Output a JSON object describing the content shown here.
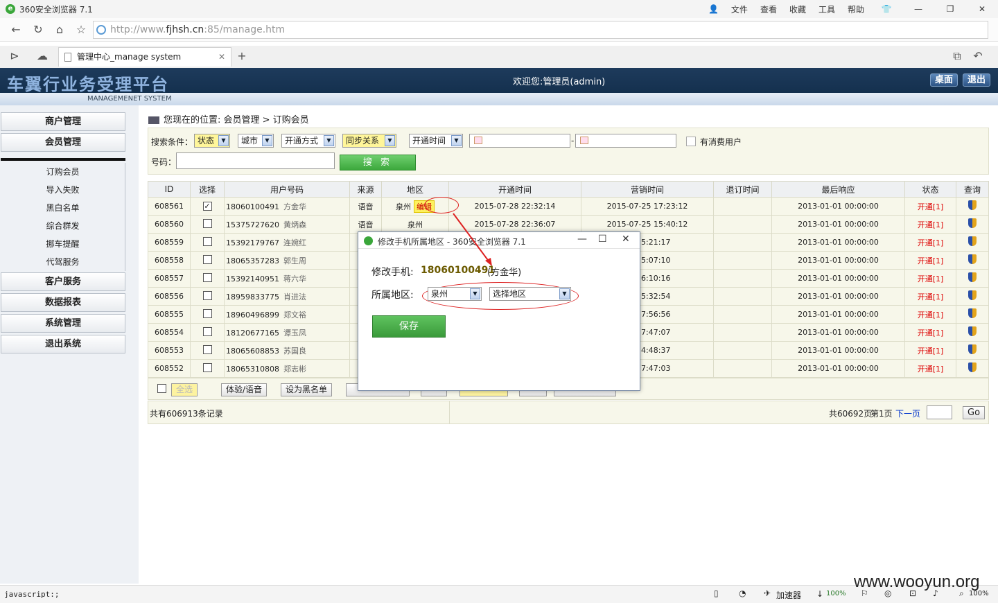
{
  "browser": {
    "title": "360安全浏览器 7.1",
    "menu": [
      "文件",
      "查看",
      "收藏",
      "工具",
      "帮助"
    ],
    "url_prefix": "http://www.",
    "url_host": "fjhsh.cn",
    "url_rest": ":85/manage.htm",
    "tab_title": "管理中心_manage system",
    "status_text": "javascript:;",
    "accelerator": "加速器",
    "zoom1": "100%",
    "zoom2": "100%"
  },
  "header": {
    "brand": "车翼行业务受理平台",
    "subtitle": "MANAGEMENET SYSTEM",
    "welcome": "欢迎您:管理员(admin)",
    "desktop_btn": "桌面",
    "logout_btn": "退出"
  },
  "sidebar": {
    "top": [
      "商户管理",
      "会员管理"
    ],
    "subs": [
      "订购会员",
      "导入失败",
      "黑白名单",
      "综合群发",
      "挪车提醒",
      "代驾服务"
    ],
    "bottom": [
      "客户服务",
      "数据报表",
      "系统管理",
      "退出系统"
    ]
  },
  "crumb": "您现在的位置: 会员管理 > 订购会员",
  "search": {
    "label": "搜索条件：",
    "status": "状态",
    "city": "城市",
    "open_mode": "开通方式",
    "sync": "同步关系",
    "open_time": "开通时间",
    "consume": "有消费用户",
    "number_label": "号码：",
    "button": "搜 索"
  },
  "table": {
    "headers": [
      "ID",
      "选择",
      "用户号码",
      "来源",
      "地区",
      "开通时间",
      "营销时间",
      "退订时间",
      "最后响应",
      "状态",
      "查询"
    ],
    "rows": [
      {
        "id": "608561",
        "phone": "18060100491",
        "name": "方金华",
        "src": "语音",
        "area": "泉州",
        "edit": "编辑",
        "open": "2015-07-28 22:32:14",
        "mkt": "2015-07-25 17:23:12",
        "last": "2013-01-01 00:00:00",
        "st": "开通[1]",
        "checked": true
      },
      {
        "id": "608560",
        "phone": "15375727620",
        "name": "黄炳森",
        "src": "语音",
        "area": "泉州",
        "edit": "",
        "open": "2015-07-28 22:36:07",
        "mkt": "2015-07-25 15:40:12",
        "last": "2013-01-01 00:00:00",
        "st": "开通[1]",
        "checked": false
      },
      {
        "id": "608559",
        "phone": "15392179767",
        "name": "连婉红",
        "src": "",
        "area": "",
        "edit": "",
        "open": "",
        "mkt": "25 15:21:17",
        "last": "2013-01-01 00:00:00",
        "st": "开通[1]",
        "checked": false
      },
      {
        "id": "608558",
        "phone": "18065357283",
        "name": "郭生周",
        "src": "",
        "area": "",
        "edit": "",
        "open": "",
        "mkt": "25 15:07:10",
        "last": "2013-01-01 00:00:00",
        "st": "开通[1]",
        "checked": false
      },
      {
        "id": "608557",
        "phone": "15392140951",
        "name": "蒋六华",
        "src": "",
        "area": "",
        "edit": "",
        "open": "",
        "mkt": "25 16:10:16",
        "last": "2013-01-01 00:00:00",
        "st": "开通[1]",
        "checked": false
      },
      {
        "id": "608556",
        "phone": "18959833775",
        "name": "肖进法",
        "src": "",
        "area": "",
        "edit": "",
        "open": "",
        "mkt": "25 15:32:54",
        "last": "2013-01-01 00:00:00",
        "st": "开通[1]",
        "checked": false
      },
      {
        "id": "608555",
        "phone": "18960496899",
        "name": "郑文裕",
        "src": "",
        "area": "",
        "edit": "",
        "open": "",
        "mkt": "25 17:56:56",
        "last": "2013-01-01 00:00:00",
        "st": "开通[1]",
        "checked": false
      },
      {
        "id": "608554",
        "phone": "18120677165",
        "name": "谭玉凤",
        "src": "",
        "area": "",
        "edit": "",
        "open": "",
        "mkt": "25 17:47:07",
        "last": "2013-01-01 00:00:00",
        "st": "开通[1]",
        "checked": false
      },
      {
        "id": "608553",
        "phone": "18065608853",
        "name": "苏国良",
        "src": "",
        "area": "",
        "edit": "",
        "open": "",
        "mkt": "25 14:48:37",
        "last": "2013-01-01 00:00:00",
        "st": "开通[1]",
        "checked": false
      },
      {
        "id": "608552",
        "phone": "18065310808",
        "name": "郑志彬",
        "src": "",
        "area": "",
        "edit": "",
        "open": "",
        "mkt": "25 17:47:03",
        "last": "2013-01-01 00:00:00",
        "st": "开通[1]",
        "checked": false
      }
    ]
  },
  "actions": {
    "select_all": "全选",
    "trial": "体验/语音",
    "blacklist": "设为黑名单"
  },
  "footer": {
    "total": "共有606913条记录",
    "pages": "共60692页",
    "current": "第1页",
    "next": "下一页",
    "go": "Go"
  },
  "dialog": {
    "title": "修改手机所属地区 - 360安全浏览器 7.1",
    "phone_label": "修改手机:",
    "phone": "18060100491",
    "owner": "(方金华)",
    "area_label": "所属地区:",
    "city": "泉州",
    "region": "选择地区",
    "save": "保存"
  },
  "watermark": "www.wooyun.org"
}
